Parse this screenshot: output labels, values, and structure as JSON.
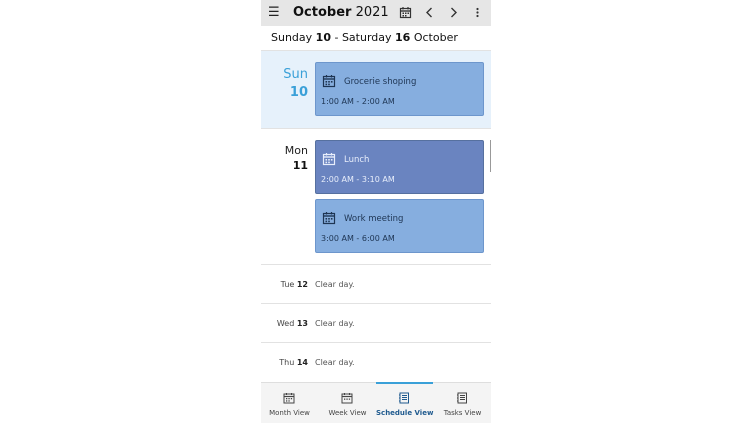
{
  "header": {
    "menu_icon": "hamburger-menu-icon",
    "month": "October",
    "year": "2021",
    "icons": [
      "calendar-icon",
      "chevron-left-icon",
      "chevron-right-icon",
      "more-vertical-icon"
    ]
  },
  "range": {
    "start_day": "Sunday",
    "start_num": "10",
    "separator": " - ",
    "end_day": "Saturday",
    "end_num": "16",
    "month": "October"
  },
  "days": [
    {
      "name": "Sun",
      "num": "10",
      "selected": true,
      "events": [
        {
          "title": "Grocerie shoping",
          "time": "1:00 AM - 2:00 AM",
          "icon": "calendar-event-icon"
        }
      ]
    },
    {
      "name": "Mon",
      "num": "11",
      "selected": false,
      "events": [
        {
          "title": "Lunch",
          "time": "2:00 AM - 3:10 AM",
          "icon": "calendar-event-icon"
        },
        {
          "title": "Work meeting",
          "time": "3:00 AM - 6:00 AM",
          "icon": "calendar-event-icon"
        }
      ]
    }
  ],
  "clear_days": [
    {
      "name": "Tue",
      "num": "12",
      "text": "Clear day."
    },
    {
      "name": "Wed",
      "num": "13",
      "text": "Clear day."
    },
    {
      "name": "Thu",
      "num": "14",
      "text": "Clear day."
    }
  ],
  "tabs": [
    {
      "label": "Month View",
      "icon": "calendar-month-icon",
      "active": false
    },
    {
      "label": "Week View",
      "icon": "calendar-week-icon",
      "active": false
    },
    {
      "label": "Schedule View",
      "icon": "schedule-list-icon",
      "active": true
    },
    {
      "label": "Tasks View",
      "icon": "tasks-list-icon",
      "active": false
    }
  ],
  "colors": {
    "accent": "#3aa0d8",
    "event_light": "#86aedf",
    "event_dark": "#6a84c0",
    "selected_day_bg": "#e6f1fb"
  }
}
